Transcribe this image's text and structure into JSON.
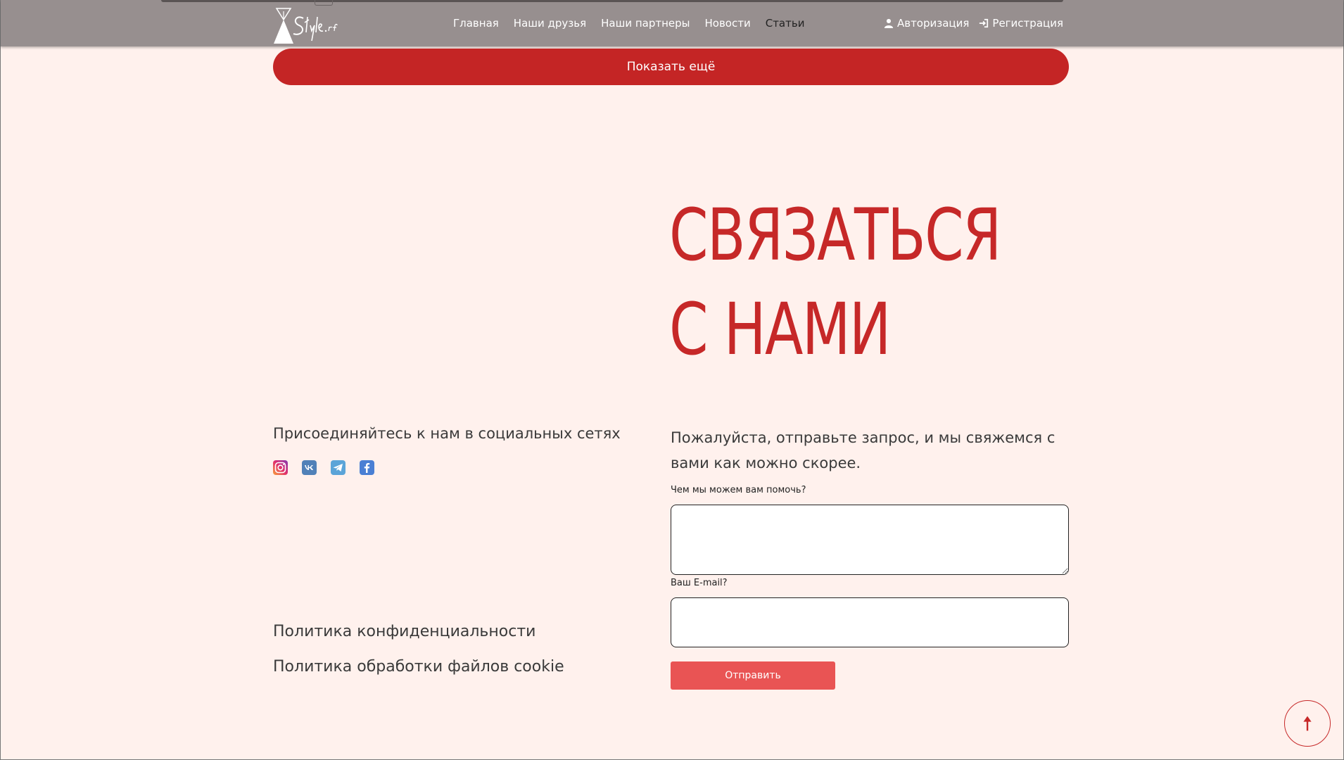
{
  "header": {
    "logo_text": "Style.rf",
    "nav": [
      {
        "label": "Главная",
        "active": false
      },
      {
        "label": "Наши друзья",
        "active": false
      },
      {
        "label": "Наши партнеры",
        "active": false
      },
      {
        "label": "Новости",
        "active": false
      },
      {
        "label": "Статьи",
        "active": true
      }
    ],
    "login_label": "Авторизация",
    "register_label": "Регистрация"
  },
  "show_more_label": "Показать ещё",
  "contact": {
    "title_line1": "СВЯЗАТЬСЯ",
    "title_line2": "С НАМИ"
  },
  "social": {
    "heading": "Присоединяйтесь к нам в социальных сетях",
    "icons": [
      "instagram-icon",
      "vk-icon",
      "telegram-icon",
      "facebook-icon"
    ]
  },
  "policies": {
    "privacy": "Политика конфиденциальности",
    "cookie": "Политика обработки файлов cookie"
  },
  "form": {
    "intro": "Пожалуйста, отправьте запрос, и мы свяжемся с вами как можно скорее.",
    "help_label": "Чем мы можем вам помочь?",
    "help_value": "",
    "email_label": "Ваш E-mail?",
    "email_value": "",
    "submit_label": "Отправить"
  },
  "colors": {
    "header_bg": "#978f8f",
    "accent": "#c42525",
    "submit": "#e95454",
    "page_bg": "#fff1ed"
  }
}
